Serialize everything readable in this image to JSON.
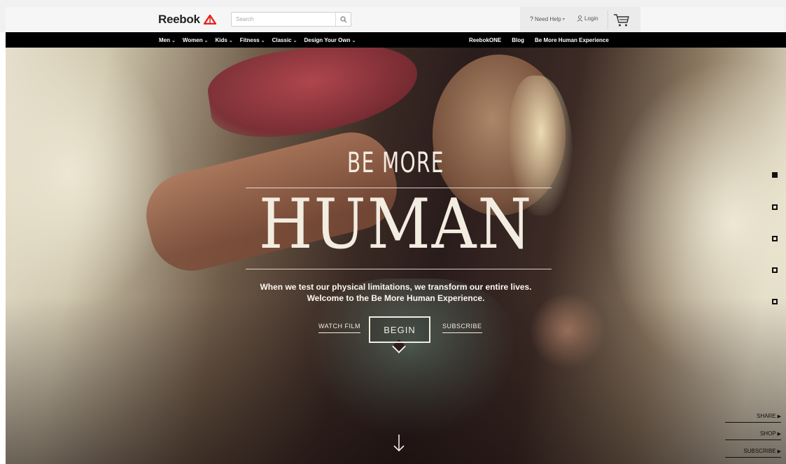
{
  "header": {
    "brand": "Reebok",
    "search_placeholder": "Search",
    "need_help": "Need Help",
    "login": "Login",
    "brand_color": "#e4231b"
  },
  "nav": {
    "left_items": [
      {
        "label": "Men"
      },
      {
        "label": "Women"
      },
      {
        "label": "Kids"
      },
      {
        "label": "Fitness"
      },
      {
        "label": "Classic"
      },
      {
        "label": "Design Your Own"
      }
    ],
    "right_items": [
      {
        "label": "ReebokONE"
      },
      {
        "label": "Blog"
      },
      {
        "label": "Be More Human Experience"
      }
    ],
    "caret": "⌄"
  },
  "hero": {
    "headline_small": "BE MORE",
    "headline_large": "HUMAN",
    "tagline_line1": "When we test our physical limitations, we transform our entire lives.",
    "tagline_line2": "Welcome to the Be More Human Experience.",
    "watch_film": "WATCH FILM",
    "begin": "BEGIN",
    "subscribe": "SUBSCRIBE",
    "down_arrow": "↓"
  },
  "slide_nav": {
    "count": 5,
    "active_index": 0
  },
  "side_links": [
    {
      "label": "SHARE"
    },
    {
      "label": "SHOP"
    },
    {
      "label": "SUBSCRIBE"
    }
  ]
}
